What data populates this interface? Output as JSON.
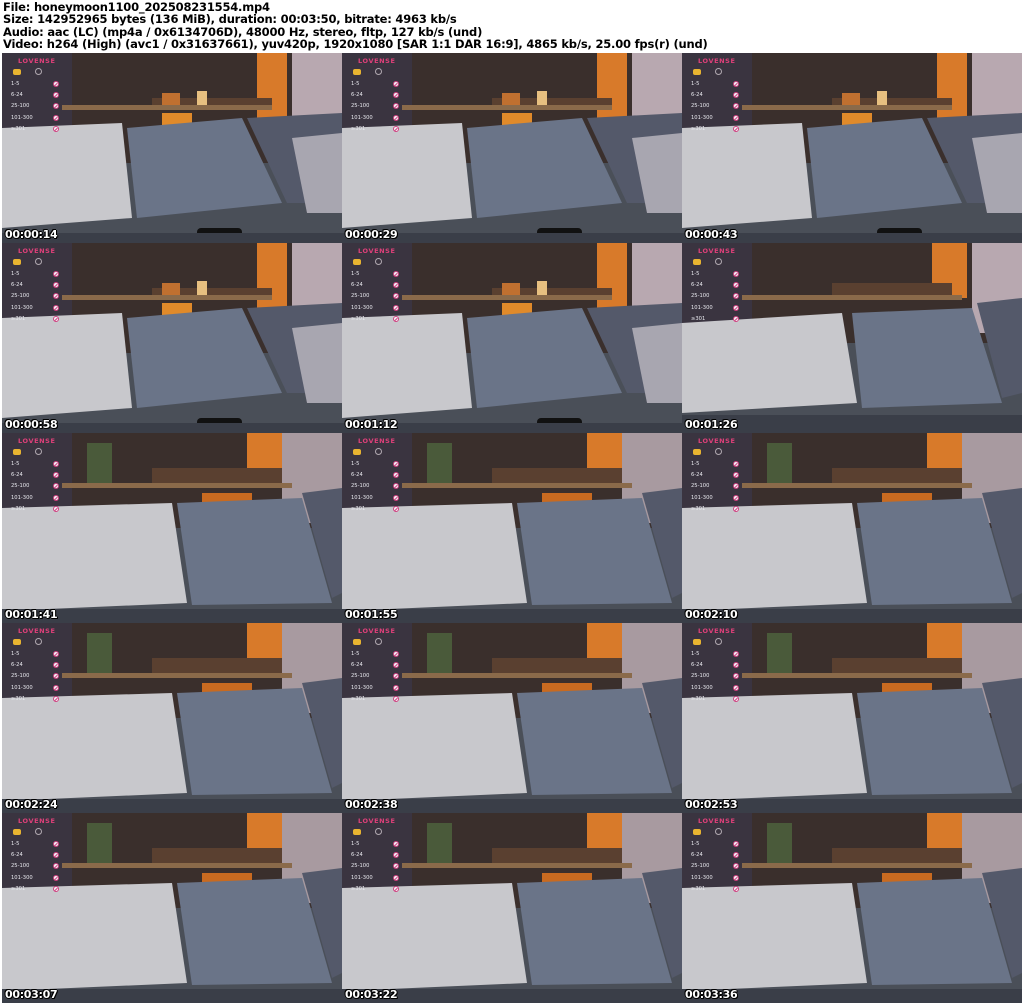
{
  "header": {
    "file": "File: honeymoon1100_202508231554.mp4",
    "size": "Size: 142952965 bytes (136 MiB), duration: 00:03:50, bitrate: 4963 kb/s",
    "audio": "Audio: aac (LC) (mp4a / 0x6134706D), 48000 Hz, stereo, fltp, 127 kb/s (und)",
    "video": "Video: h264 (High) (avc1 / 0x31637661), yuv420p, 1920x1080 [SAR 1:1 DAR 16:9], 4865 kb/s, 25.00 fps(r) (und)"
  },
  "overlay": {
    "brand": "LOVENSE",
    "levels": [
      "1-5",
      "6-24",
      "25-100",
      "101-300",
      "≥301"
    ]
  },
  "thumbnails": [
    {
      "time": "00:00:14",
      "variant": "a"
    },
    {
      "time": "00:00:29",
      "variant": "a"
    },
    {
      "time": "00:00:43",
      "variant": "a"
    },
    {
      "time": "00:00:58",
      "variant": "a"
    },
    {
      "time": "00:01:12",
      "variant": "a"
    },
    {
      "time": "00:01:26",
      "variant": "b"
    },
    {
      "time": "00:01:41",
      "variant": "c"
    },
    {
      "time": "00:01:55",
      "variant": "c"
    },
    {
      "time": "00:02:10",
      "variant": "c"
    },
    {
      "time": "00:02:24",
      "variant": "c"
    },
    {
      "time": "00:02:38",
      "variant": "c"
    },
    {
      "time": "00:02:53",
      "variant": "c"
    },
    {
      "time": "00:03:07",
      "variant": "c"
    },
    {
      "time": "00:03:22",
      "variant": "c"
    },
    {
      "time": "00:03:36",
      "variant": "c"
    }
  ],
  "colors": {
    "wall": "#3a2f2c",
    "lamp": "#d87a2a",
    "shelf": "#8a6a4a",
    "pillow_light": "#c8c8cc",
    "pillow_blue": "#6a7488",
    "sofa": "#4a4f58",
    "brand": "#e0407a"
  }
}
